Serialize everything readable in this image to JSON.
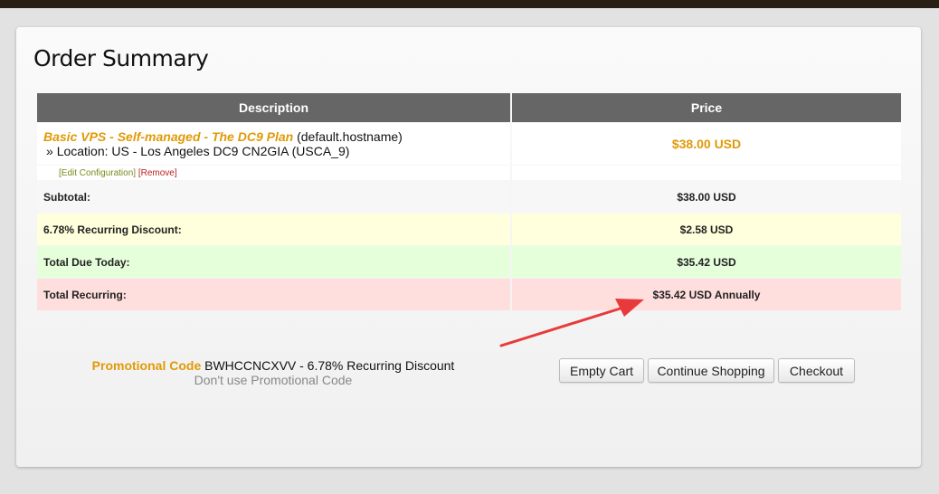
{
  "page": {
    "title": "Order Summary"
  },
  "table": {
    "headers": {
      "description": "Description",
      "price": "Price"
    },
    "item": {
      "product_name": "Basic VPS - Self-managed - The DC9 Plan",
      "hostname": "(default.hostname)",
      "location_bullet": "»",
      "location": "Location: US - Los Angeles DC9 CN2GIA (USCA_9)",
      "price": "$38.00 USD",
      "edit_link": "[Edit Configuration]",
      "remove_link": "[Remove]"
    },
    "summary": [
      {
        "label": "Subtotal:",
        "value": "$38.00 USD"
      },
      {
        "label": "6.78% Recurring Discount:",
        "value": "$2.58 USD"
      },
      {
        "label": "Total Due Today:",
        "value": "$35.42 USD"
      },
      {
        "label": "Total Recurring:",
        "value": "$35.42 USD Annually"
      }
    ]
  },
  "promo": {
    "label": "Promotional Code",
    "code_text": "BWHCCNCXVV - 6.78% Recurring Discount",
    "remove_text": "Don't use Promotional Code"
  },
  "buttons": {
    "empty_cart": "Empty Cart",
    "continue_shopping": "Continue Shopping",
    "checkout": "Checkout"
  },
  "colors": {
    "accent": "#e09a06",
    "header_bg": "#666666",
    "discount_row": "#ffffdd",
    "today_row": "#e6ffdb",
    "recurring_row": "#ffdede",
    "annotation_arrow": "#e83a3a"
  }
}
